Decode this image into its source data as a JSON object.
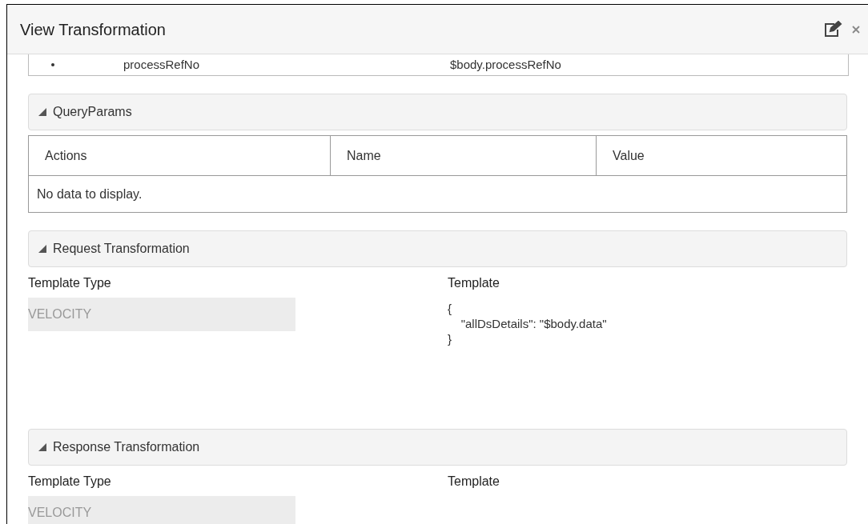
{
  "dialog": {
    "title": "View Transformation"
  },
  "upper_table": {
    "rows": [
      {
        "column_1": "processRefNo",
        "column_2": "$body.processRefNo"
      }
    ]
  },
  "query_params": {
    "title": "QueryParams",
    "expanded": true,
    "columns": [
      "Actions",
      "Name",
      "Value"
    ],
    "empty_message": "No data to display."
  },
  "transformations": [
    {
      "title": "Request Transformation",
      "expanded": true,
      "template_type_label": "Template Type",
      "template_type_value": "VELOCITY",
      "template_label": "Template",
      "template": "{\n    \"allDsDetails\": \"$body.data\"\n}"
    },
    {
      "title": "Response Transformation",
      "expanded": true,
      "template_type_label": "Template Type",
      "template_type_value": "VELOCITY",
      "template_label": "Template"
    }
  ]
}
